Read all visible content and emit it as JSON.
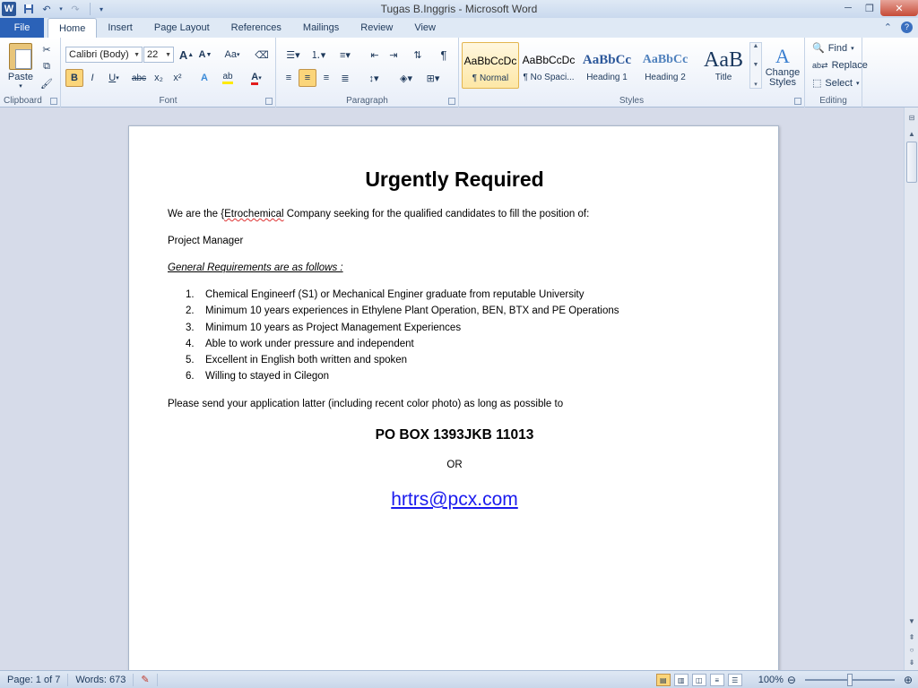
{
  "window": {
    "title": "Tugas B.Inggris - Microsoft Word",
    "app_icon": "W",
    "controls": {
      "minimize": "─",
      "maximize": "❐",
      "close": "✕"
    }
  },
  "qat": {
    "save_icon": "save-icon",
    "undo_icon": "undo-icon",
    "redo_icon": "redo-icon"
  },
  "tabs": [
    "File",
    "Home",
    "Insert",
    "Page Layout",
    "References",
    "Mailings",
    "Review",
    "View"
  ],
  "active_tab": "Home",
  "ribbon": {
    "clipboard": {
      "label": "Clipboard",
      "paste": "Paste"
    },
    "font": {
      "label": "Font",
      "family": "Calibri (Body)",
      "size": "22",
      "grow": "A",
      "shrink": "A",
      "change_case": "Aa",
      "bold": "B",
      "italic": "I",
      "underline": "U",
      "strike": "abc",
      "subscript": "x₂",
      "superscript": "x²",
      "font_color": "A"
    },
    "paragraph": {
      "label": "Paragraph",
      "pilcrow": "¶"
    },
    "styles": {
      "label": "Styles",
      "items": [
        {
          "sample": "AaBbCcDc",
          "name": "¶ Normal"
        },
        {
          "sample": "AaBbCcDc",
          "name": "¶ No Spaci..."
        },
        {
          "sample": "AaBbCc",
          "name": "Heading 1"
        },
        {
          "sample": "AaBbCc",
          "name": "Heading 2"
        },
        {
          "sample": "AaB",
          "name": "Title"
        }
      ],
      "change_styles": "Change Styles"
    },
    "editing": {
      "label": "Editing",
      "find": "Find",
      "replace": "Replace",
      "select": "Select"
    }
  },
  "document": {
    "title": "Urgently Required",
    "intro_pre": "We are the {",
    "intro_typo": "Etrochemical",
    "intro_post": " Company seeking for the qualified candidates to fill the position of:",
    "position": "Project Manager",
    "req_heading": "General Requirements are as follows :",
    "requirements": [
      "Chemical Engineerf (S1) or Mechanical Enginer graduate from reputable University",
      "Minimum 10 years experiences in Ethylene Plant Operation, BEN, BTX and PE Operations",
      "Minimum 10 years as Project Management Experiences",
      "Able to work under pressure and independent",
      "Excellent in English both written and spoken",
      "Willing to stayed in Cilegon"
    ],
    "send_line": "Please send your application latter (including recent color photo) as long as possible to",
    "po_box": "PO BOX 1393JKB 11013",
    "or": "OR",
    "email": "hrtrs@pcx.com"
  },
  "status": {
    "page": "Page: 1 of 7",
    "words": "Words: 673",
    "zoom": "100%"
  },
  "colors": {
    "accent": "#2b62b8",
    "link": "#1a1aee",
    "selected_style": "#fde7a6"
  }
}
